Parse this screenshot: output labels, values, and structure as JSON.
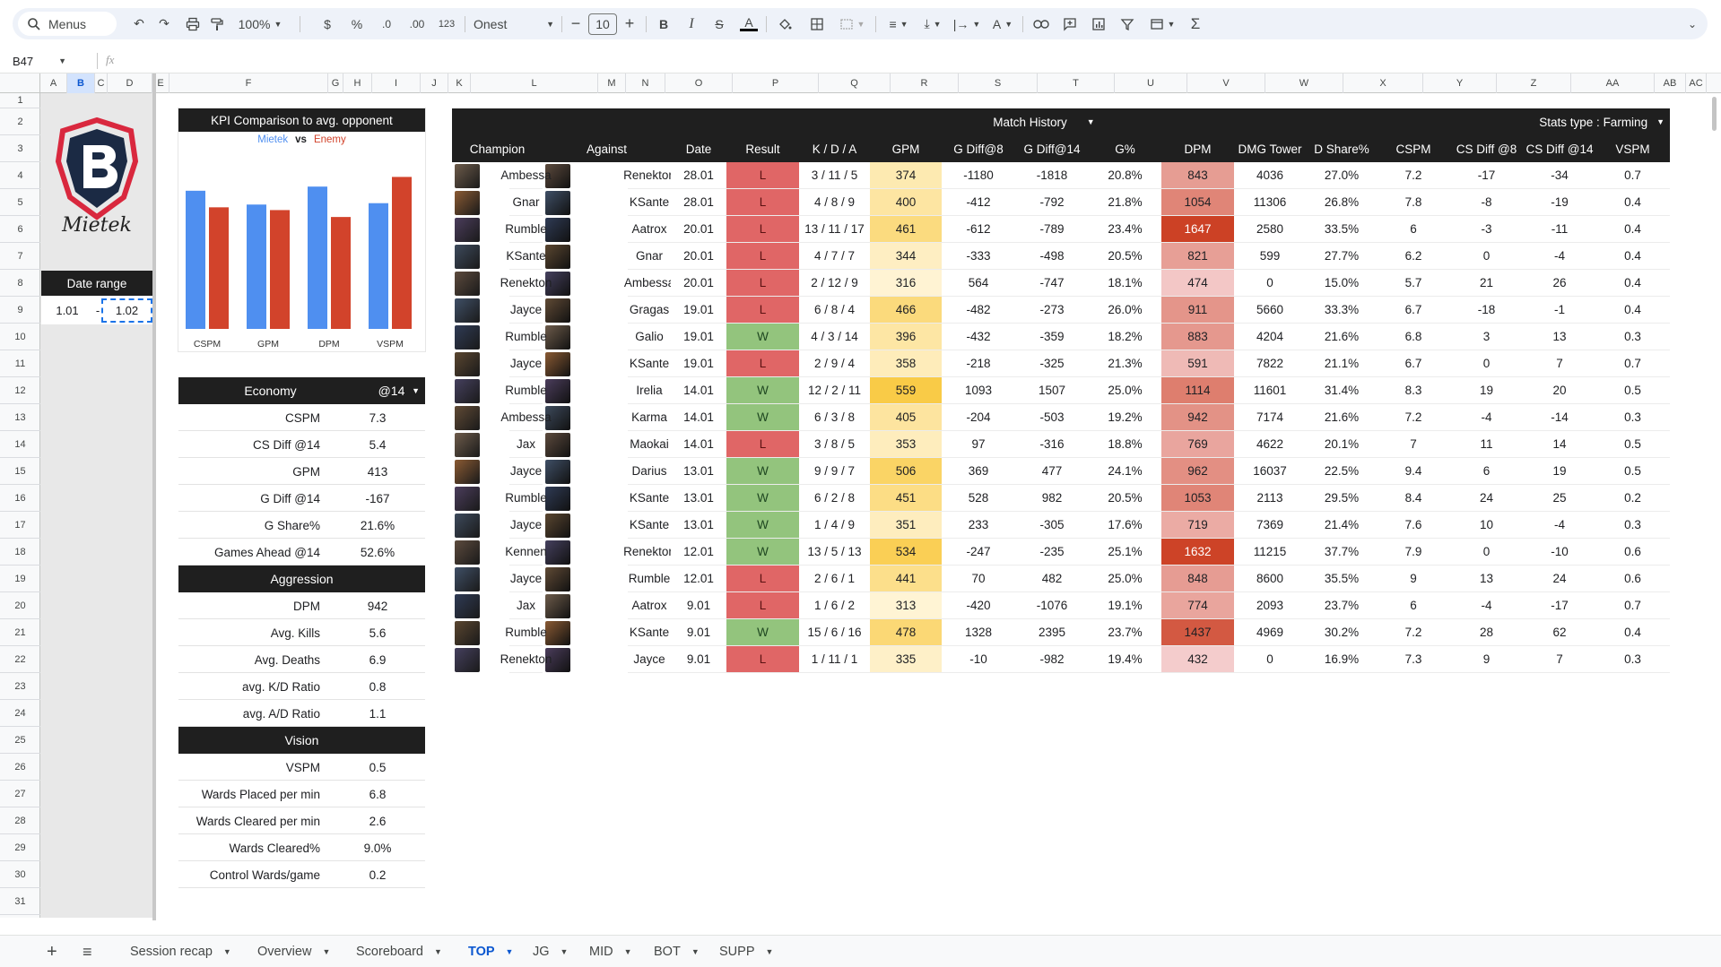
{
  "toolbar": {
    "menus_label": "Menus",
    "zoom": "100%",
    "currency": "$",
    "percent": "%",
    "dec_decrease": ".0",
    "dec_increase": ".00",
    "number_format": "123",
    "font_name": "Onest",
    "font_size": "10",
    "bold": "B",
    "italic": "I",
    "strike": "S",
    "text_color": "A"
  },
  "formula_bar": {
    "cell_ref": "B47",
    "fx": "fx"
  },
  "columns": [
    "A",
    "B",
    "C",
    "D",
    "E",
    "F",
    "G",
    "H",
    "I",
    "J",
    "K",
    "L",
    "M",
    "N",
    "O",
    "P",
    "Q",
    "R",
    "S",
    "T",
    "U",
    "V",
    "W",
    "X",
    "Y",
    "Z",
    "AA",
    "AB",
    "AC"
  ],
  "rows": [
    "1",
    "2",
    "3",
    "4",
    "5",
    "6",
    "7",
    "8",
    "9",
    "10",
    "11",
    "12",
    "13",
    "14",
    "15",
    "16",
    "17",
    "18",
    "19",
    "20",
    "21",
    "22",
    "23",
    "24",
    "25",
    "26",
    "27",
    "28",
    "29",
    "30",
    "31"
  ],
  "logo": {
    "signature": "Mietek"
  },
  "date_range": {
    "title": "Date range",
    "from": "1.01",
    "dash": "-",
    "to": "1.02"
  },
  "kpi_chart": {
    "title": "KPI Comparison to avg. opponent",
    "vs": "vs"
  },
  "chart_data": {
    "type": "bar",
    "title": "KPI Comparison to avg. opponent",
    "categories": [
      "CSPM",
      "GPM",
      "DPM",
      "VSPM"
    ],
    "series": [
      {
        "name": "Mietek",
        "color": "#4f8ff0",
        "values": [
          1.0,
          0.9,
          1.03,
          0.91
        ]
      },
      {
        "name": "Enemy",
        "color": "#d2432b",
        "values": [
          0.88,
          0.86,
          0.81,
          1.1
        ]
      }
    ],
    "ylim": [
      0,
      1.2
    ],
    "legend": "top-center",
    "grid": false
  },
  "economy": {
    "title": "Economy",
    "selector": "@14",
    "rows": [
      {
        "label": "CSPM",
        "value": "7.3"
      },
      {
        "label": "CS Diff @14",
        "value": "5.4"
      },
      {
        "label": "GPM",
        "value": "413"
      },
      {
        "label": "G Diff @14",
        "value": "-167"
      },
      {
        "label": "G Share%",
        "value": "21.6%"
      },
      {
        "label": "Games Ahead @14",
        "value": "52.6%"
      }
    ]
  },
  "aggression": {
    "title": "Aggression",
    "rows": [
      {
        "label": "DPM",
        "value": "942"
      },
      {
        "label": "Avg. Kills",
        "value": "5.6"
      },
      {
        "label": "Avg. Deaths",
        "value": "6.9"
      },
      {
        "label": "avg. K/D Ratio",
        "value": "0.8"
      },
      {
        "label": "avg. A/D Ratio",
        "value": "1.1"
      }
    ]
  },
  "vision": {
    "title": "Vision",
    "rows": [
      {
        "label": "VSPM",
        "value": "0.5"
      },
      {
        "label": "Wards Placed per min",
        "value": "6.8"
      },
      {
        "label": "Wards Cleared per min",
        "value": "2.6"
      },
      {
        "label": "Wards Cleared%",
        "value": "9.0%"
      },
      {
        "label": "Control Wards/game",
        "value": "0.2"
      }
    ]
  },
  "match_history": {
    "title": "Match History",
    "stats_type_label": "Stats type :",
    "stats_type_value": "Farming",
    "headers": [
      "Champion",
      "Against",
      "Date",
      "Result",
      "K / D / A",
      "GPM",
      "G Diff@8",
      "G Diff@14",
      "G%",
      "DPM",
      "DMG Tower",
      "D Share%",
      "CSPM",
      "CS Diff @8",
      "CS Diff @14",
      "VSPM"
    ],
    "rows": [
      [
        "Ambessa",
        "Renekton",
        "28.01",
        "L",
        "3 / 11 / 5",
        "374",
        "-1180",
        "-1818",
        "20.8%",
        "843",
        "4036",
        "27.0%",
        "7.2",
        "-17",
        "-34",
        "0.7"
      ],
      [
        "Gnar",
        "KSante",
        "28.01",
        "L",
        "4 / 8 / 9",
        "400",
        "-412",
        "-792",
        "21.8%",
        "1054",
        "11306",
        "26.8%",
        "7.8",
        "-8",
        "-19",
        "0.4"
      ],
      [
        "Rumble",
        "Aatrox",
        "20.01",
        "L",
        "13 / 11 / 17",
        "461",
        "-612",
        "-789",
        "23.4%",
        "1647",
        "2580",
        "33.5%",
        "6",
        "-3",
        "-11",
        "0.4"
      ],
      [
        "KSante",
        "Gnar",
        "20.01",
        "L",
        "4 / 7 / 7",
        "344",
        "-333",
        "-498",
        "20.5%",
        "821",
        "599",
        "27.7%",
        "6.2",
        "0",
        "-4",
        "0.4"
      ],
      [
        "Renekton",
        "Ambessa",
        "20.01",
        "L",
        "2 / 12 / 9",
        "316",
        "564",
        "-747",
        "18.1%",
        "474",
        "0",
        "15.0%",
        "5.7",
        "21",
        "26",
        "0.4"
      ],
      [
        "Jayce",
        "Gragas",
        "19.01",
        "L",
        "6 / 8 / 4",
        "466",
        "-482",
        "-273",
        "26.0%",
        "911",
        "5660",
        "33.3%",
        "6.7",
        "-18",
        "-1",
        "0.4"
      ],
      [
        "Rumble",
        "Galio",
        "19.01",
        "W",
        "4 / 3 / 14",
        "396",
        "-432",
        "-359",
        "18.2%",
        "883",
        "4204",
        "21.6%",
        "6.8",
        "3",
        "13",
        "0.3"
      ],
      [
        "Jayce",
        "KSante",
        "19.01",
        "L",
        "2 / 9 / 4",
        "358",
        "-218",
        "-325",
        "21.3%",
        "591",
        "7822",
        "21.1%",
        "6.7",
        "0",
        "7",
        "0.7"
      ],
      [
        "Rumble",
        "Irelia",
        "14.01",
        "W",
        "12 / 2 / 11",
        "559",
        "1093",
        "1507",
        "25.0%",
        "1114",
        "11601",
        "31.4%",
        "8.3",
        "19",
        "20",
        "0.5"
      ],
      [
        "Ambessa",
        "Karma",
        "14.01",
        "W",
        "6 / 3 / 8",
        "405",
        "-204",
        "-503",
        "19.2%",
        "942",
        "7174",
        "21.6%",
        "7.2",
        "-4",
        "-14",
        "0.3"
      ],
      [
        "Jax",
        "Maokai",
        "14.01",
        "L",
        "3 / 8 / 5",
        "353",
        "97",
        "-316",
        "18.8%",
        "769",
        "4622",
        "20.1%",
        "7",
        "11",
        "14",
        "0.5"
      ],
      [
        "Jayce",
        "Darius",
        "13.01",
        "W",
        "9 / 9 / 7",
        "506",
        "369",
        "477",
        "24.1%",
        "962",
        "16037",
        "22.5%",
        "9.4",
        "6",
        "19",
        "0.5"
      ],
      [
        "Rumble",
        "KSante",
        "13.01",
        "W",
        "6 / 2 / 8",
        "451",
        "528",
        "982",
        "20.5%",
        "1053",
        "2113",
        "29.5%",
        "8.4",
        "24",
        "25",
        "0.2"
      ],
      [
        "Jayce",
        "KSante",
        "13.01",
        "W",
        "1 / 4 / 9",
        "351",
        "233",
        "-305",
        "17.6%",
        "719",
        "7369",
        "21.4%",
        "7.6",
        "10",
        "-4",
        "0.3"
      ],
      [
        "Kennen",
        "Renekton",
        "12.01",
        "W",
        "13 / 5 / 13",
        "534",
        "-247",
        "-235",
        "25.1%",
        "1632",
        "11215",
        "37.7%",
        "7.9",
        "0",
        "-10",
        "0.6"
      ],
      [
        "Jayce",
        "Rumble",
        "12.01",
        "L",
        "2 / 6 / 1",
        "441",
        "70",
        "482",
        "25.0%",
        "848",
        "8600",
        "35.5%",
        "9",
        "13",
        "24",
        "0.6"
      ],
      [
        "Jax",
        "Aatrox",
        "9.01",
        "L",
        "1 / 6 / 2",
        "313",
        "-420",
        "-1076",
        "19.1%",
        "774",
        "2093",
        "23.7%",
        "6",
        "-4",
        "-17",
        "0.7"
      ],
      [
        "Rumble",
        "KSante",
        "9.01",
        "W",
        "15 / 6 / 16",
        "478",
        "1328",
        "2395",
        "23.7%",
        "1437",
        "4969",
        "30.2%",
        "7.2",
        "28",
        "62",
        "0.4"
      ],
      [
        "Renekton",
        "Jayce",
        "9.01",
        "L",
        "1 / 11 / 1",
        "335",
        "-10",
        "-982",
        "19.4%",
        "432",
        "0",
        "16.9%",
        "7.3",
        "9",
        "7",
        "0.3"
      ]
    ]
  },
  "sheet_tabs": [
    {
      "label": "Session recap",
      "active": false
    },
    {
      "label": "Overview",
      "active": false
    },
    {
      "label": "Scoreboard",
      "active": false
    },
    {
      "label": "TOP",
      "active": true
    },
    {
      "label": "JG",
      "active": false
    },
    {
      "label": "MID",
      "active": false
    },
    {
      "label": "BOT",
      "active": false
    },
    {
      "label": "SUPP",
      "active": false
    }
  ],
  "colors": {
    "win": "#93c47d",
    "loss": "#e06666",
    "header_dark": "#1f1f1f",
    "accent_blue": "#0b57d0"
  }
}
